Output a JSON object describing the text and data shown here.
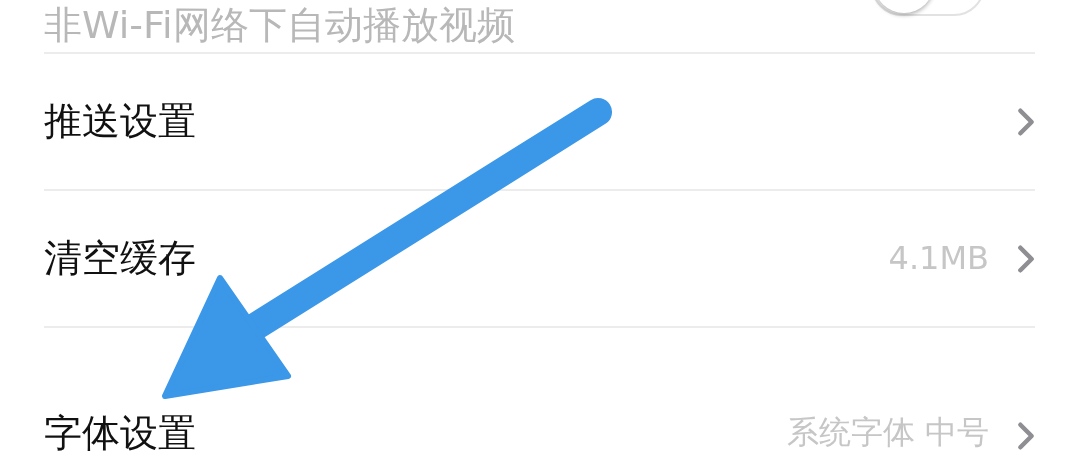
{
  "settings": [
    {
      "kind": "toggle",
      "label": "非Wi-Fi网络下自动播放视频",
      "on": false
    },
    {
      "kind": "link",
      "label": "推送设置"
    },
    {
      "kind": "link",
      "label": "清空缓存",
      "value": "4.1MB"
    },
    {
      "kind": "link",
      "label": "字体设置",
      "value": "系统字体 中号"
    }
  ],
  "annotation": {
    "kind": "arrow"
  }
}
